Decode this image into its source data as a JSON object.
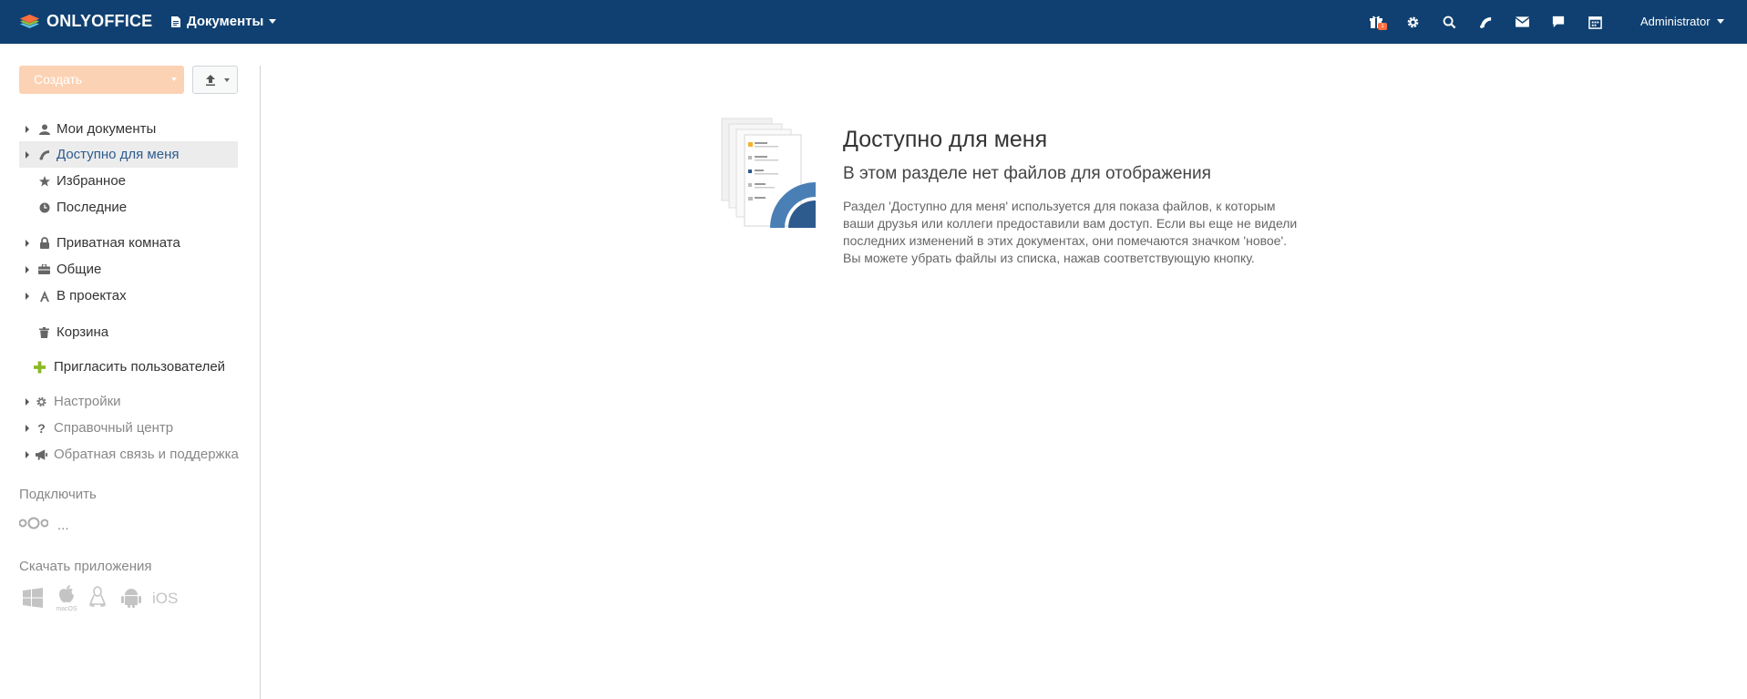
{
  "topbar": {
    "logo_text": "ONLYOFFICE",
    "module_label": "Документы",
    "icons": [
      "gift-icon",
      "gear-icon",
      "search-icon",
      "feed-icon",
      "mail-icon",
      "chat-icon",
      "calendar-icon"
    ],
    "gift_badge": "1",
    "user_name": "Administrator",
    "colors": {
      "bar": "#0f4071",
      "badge": "#ff6f3d"
    }
  },
  "sidebar": {
    "create_label": "Создать",
    "nav": [
      {
        "label": "Мои документы",
        "icon": "user-icon"
      },
      {
        "label": "Доступно для меня",
        "icon": "shared-icon",
        "active": true
      },
      {
        "label": "Избранное",
        "icon": "star-icon"
      },
      {
        "label": "Последние",
        "icon": "clock-icon"
      },
      {
        "label": "Приватная комната",
        "icon": "lock-icon"
      },
      {
        "label": "Общие",
        "icon": "briefcase-icon"
      },
      {
        "label": "В проектах",
        "icon": "projects-icon"
      },
      {
        "label": "Корзина",
        "icon": "trash-icon"
      }
    ],
    "invite_label": "Пригласить пользователей",
    "tools": [
      {
        "label": "Настройки",
        "icon": "gear-icon"
      },
      {
        "label": "Справочный центр",
        "icon": "question-icon"
      },
      {
        "label": "Обратная связь и поддержка",
        "icon": "megaphone-icon"
      }
    ],
    "connect_title": "Подключить",
    "connect_more": "...",
    "apps_title": "Скачать приложения",
    "apps": [
      "windows-icon",
      "apple-icon",
      "linux-icon",
      "android-icon"
    ],
    "macos_caption": "macOS",
    "ios_label": "iOS",
    "colors": {
      "active_text": "#2d5b8e",
      "active_bg": "#ececec",
      "create_bg": "#fcd2b4",
      "invite_plus": "#8bb825"
    }
  },
  "main": {
    "empty_title": "Доступно для меня",
    "empty_subtitle": "В этом разделе нет файлов для отображения",
    "empty_description": "Раздел 'Доступно для меня' используется для показа файлов, к которым ваши друзья или коллеги предоставили вам доступ. Если вы еще не видели последних изменений в этих документах, они помечаются значком 'новое'. Вы можете убрать файлы из списка, нажав соответствующую кнопку."
  }
}
